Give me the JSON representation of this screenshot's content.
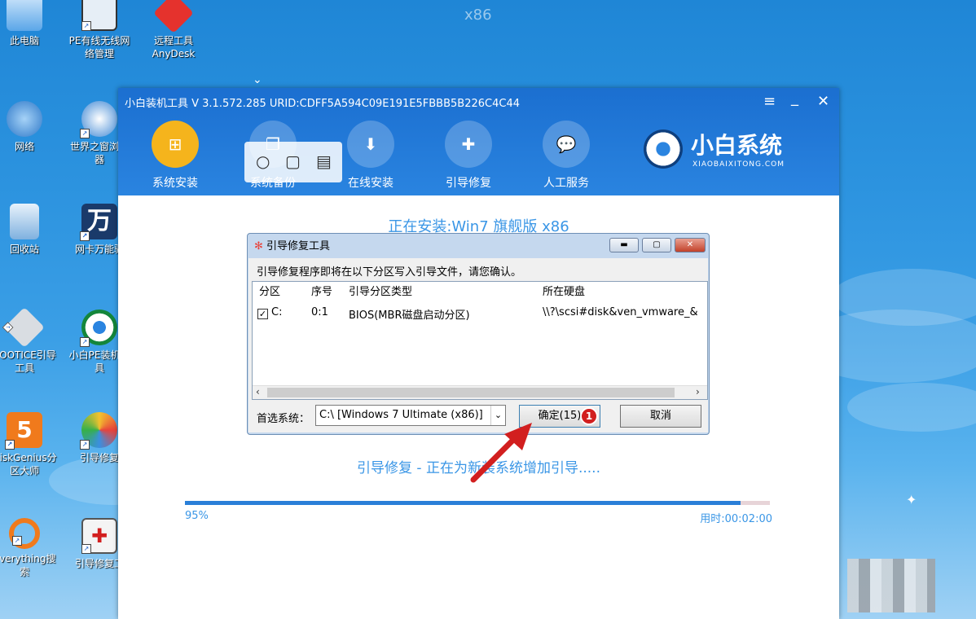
{
  "desktop": {
    "watermark": "x86",
    "icons": [
      {
        "label": "此电脑",
        "icon": "computer-icon"
      },
      {
        "label": "PE有线无线网络管理",
        "icon": "network-manager-icon"
      },
      {
        "label": "远程工具AnyDesk",
        "icon": "anydesk-icon"
      },
      {
        "label": "网络",
        "icon": "network-globe-icon"
      },
      {
        "label": "世界之窗浏览器",
        "icon": "browser-globe-icon"
      },
      {
        "label": "回收站",
        "icon": "recycle-bin-icon"
      },
      {
        "label": "网卡万能驱",
        "icon": "driver-wan-icon"
      },
      {
        "label": "BOOTICE引导工具",
        "icon": "bootice-icon"
      },
      {
        "label": "小白PE装机工具",
        "icon": "xiaobai-pe-icon"
      },
      {
        "label": "DiskGenius分区大师",
        "icon": "diskgenius-icon"
      },
      {
        "label": "引导修复",
        "icon": "pinwheel-icon"
      },
      {
        "label": "Everything搜索",
        "icon": "everything-search-icon"
      },
      {
        "label": "引导修复工",
        "icon": "repair-kit-icon"
      }
    ]
  },
  "app": {
    "title": "小白装机工具 V 3.1.572.285 URID:CDFF5A594C09E191E5FBBB5B226C4C44",
    "controls": {
      "menu": "≡",
      "minimize": "_",
      "close": "✕"
    },
    "nav": [
      {
        "label": "系统安装",
        "active": true,
        "glyph": "⊞"
      },
      {
        "label": "系统备份",
        "active": false,
        "glyph": "❐"
      },
      {
        "label": "在线安装",
        "active": false,
        "glyph": "⬇"
      },
      {
        "label": "引导修复",
        "active": false,
        "glyph": "✚"
      },
      {
        "label": "人工服务",
        "active": false,
        "glyph": "💬"
      }
    ],
    "logo": {
      "name": "小白系统",
      "sub": "XIAOBAIXITONG.COM"
    },
    "installing_text": "正在安装:Win7 旗舰版 x86",
    "status_text": "引导修复 - 正在为新装系统增加引导.....",
    "progress": {
      "percent_label": "95%",
      "value": 0.95,
      "elapsed": "用时:00:02:00"
    }
  },
  "toolbox": {
    "icons": [
      "search-icon",
      "chat-icon",
      "note-icon"
    ]
  },
  "dialog": {
    "title": "引导修复工具",
    "message": "引导修复程序即将在以下分区写入引导文件，请您确认。",
    "columns": [
      "分区",
      "序号",
      "引导分区类型",
      "所在硬盘"
    ],
    "rows": [
      {
        "checked": true,
        "partition": "C:",
        "index": "0:1",
        "type": "BIOS(MBR磁盘启动分区)",
        "disk": "\\\\?\\scsi#disk&ven_vmware_&"
      }
    ],
    "preferred_label": "首选系统：",
    "preferred_value": "C:\\ [Windows 7 Ultimate (x86)]",
    "ok_label": "确定(15)",
    "cancel_label": "取消"
  },
  "annotation": {
    "badge": "1",
    "color": "#d21f1f"
  }
}
